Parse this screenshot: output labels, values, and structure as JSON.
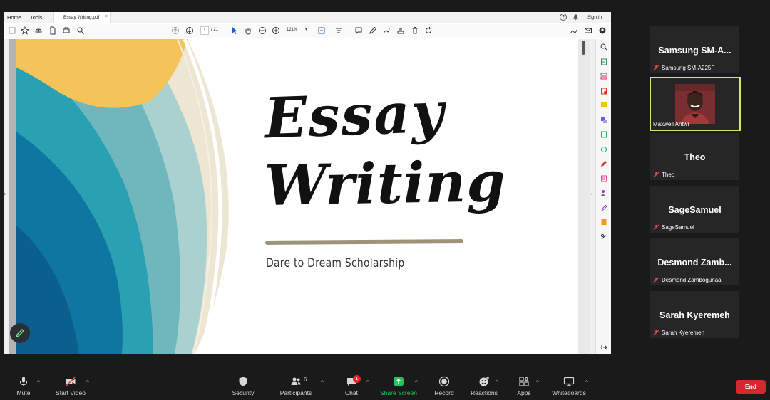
{
  "app": {
    "accent": "#22c55e",
    "end_color": "#d2282e"
  },
  "viewer": {
    "menu": {
      "home": "Home",
      "tools": "Tools"
    },
    "tab": {
      "title": "Essay Writing.pdf",
      "close": "×"
    },
    "signin": "Sign In",
    "page_number": "1",
    "page_total": "/ 21",
    "zoom": "121%",
    "document": {
      "title_line1": "Essay",
      "title_line2": "Writing",
      "subtitle": "Dare to Dream Scholarship"
    }
  },
  "participants": [
    {
      "display": "Samsung SM-A...",
      "label": "Samsung SM-A225F"
    },
    {
      "display": "Maxwell Antwi",
      "label": "Maxwell Antwi"
    },
    {
      "display": "Theo",
      "label": "Theo"
    },
    {
      "display": "SageSamuel",
      "label": "SageSamuel"
    },
    {
      "display": "Desmond Zamb...",
      "label": "Desmond Zambogunaa"
    },
    {
      "display": "Sarah Kyeremeh",
      "label": "Sarah Kyeremeh"
    }
  ],
  "controls": {
    "mute": "Mute",
    "start_video": "Start Video",
    "security": "Security",
    "participants": "Participants",
    "participants_count": "6",
    "chat": "Chat",
    "chat_badge": "1",
    "share_screen": "Share Screen",
    "record": "Record",
    "reactions": "Reactions",
    "apps": "Apps",
    "whiteboards": "Whiteboards",
    "end": "End"
  }
}
